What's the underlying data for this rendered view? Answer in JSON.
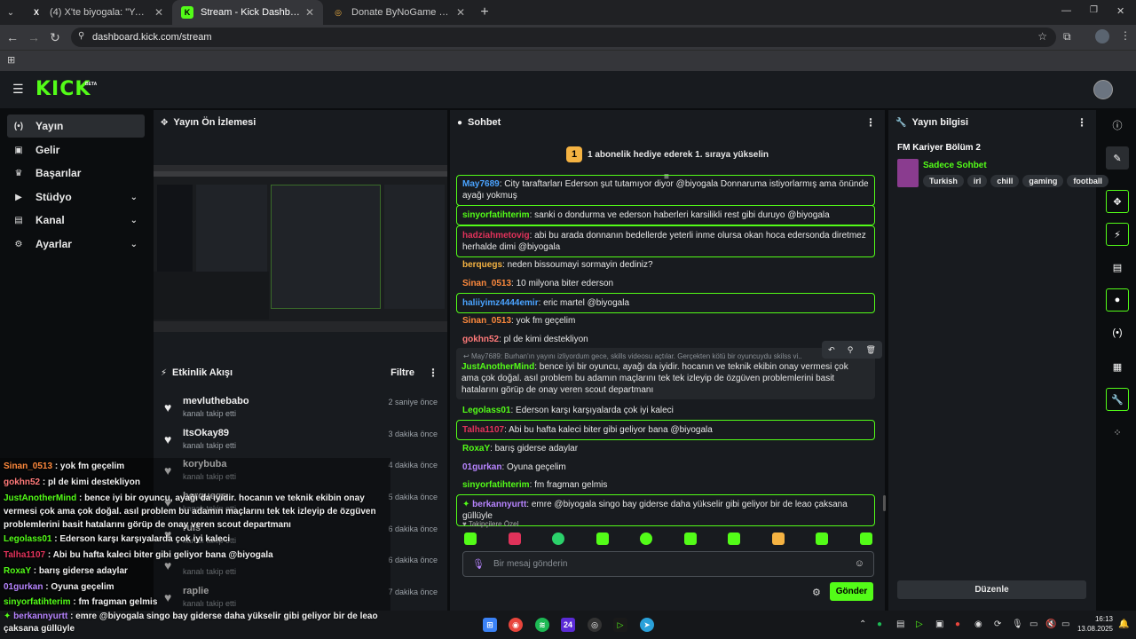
{
  "browser": {
    "tabs": [
      {
        "label": "(4) X'te biyogala: \"Yayındayız! F",
        "favicon": "x-logo-icon"
      },
      {
        "label": "Stream - Kick Dashboard",
        "favicon": "kick-logo-icon"
      },
      {
        "label": "Donate ByNoGame - Streamer",
        "favicon": "donate-icon"
      }
    ],
    "url": "dashboard.kick.com/stream"
  },
  "header": {
    "logo": "KICK",
    "badge": "BETA"
  },
  "sidebar": {
    "items": [
      {
        "label": "Yayın",
        "icon": "broadcast-icon"
      },
      {
        "label": "Gelir",
        "icon": "revenue-icon"
      },
      {
        "label": "Başarılar",
        "icon": "trophy-icon"
      },
      {
        "label": "Stüdyo",
        "icon": "studio-icon"
      },
      {
        "label": "Kanal",
        "icon": "channel-icon"
      },
      {
        "label": "Ayarlar",
        "icon": "gear-icon"
      }
    ]
  },
  "preview": {
    "title": "Yayın Ön İzlemesi"
  },
  "activity": {
    "title": "Etkinlik Akışı",
    "filter": "Filtre",
    "items": [
      {
        "name": "mevluthebabo",
        "sub": "kanalı takip etti",
        "time": "2 saniye önce"
      },
      {
        "name": "ItsOkay89",
        "sub": "kanalı takip etti",
        "time": "3 dakika önce"
      },
      {
        "name": "korybuba",
        "sub": "kanalı takip etti",
        "time": "4 dakika önce"
      },
      {
        "name": "berqueqs",
        "sub": "kanalı takip etti",
        "time": "5 dakika önce"
      },
      {
        "name": "ruis",
        "sub": "kanalı takip etti",
        "time": "6 dakika önce"
      },
      {
        "name": "",
        "sub": "kanalı takip etti",
        "time": "6 dakika önce"
      },
      {
        "name": "raplie",
        "sub": "kanalı takip etti",
        "time": "7 dakika önce"
      }
    ]
  },
  "chat": {
    "title": "Sohbet",
    "banner": "1 abonelik hediye ederek 1. sıraya yükselin",
    "messages": [
      {
        "user": "May7689",
        "color": "#4aa3ff",
        "text": ": City taraftarları Ederson şut tutamıyor diyor @biyogala Donnaruma istiyorlarmış ama önünde ayağı yokmuş",
        "hl": true
      },
      {
        "user": "sinyorfatihterim",
        "color": "#53fc18",
        "text": ": sanki o dondurma ve ederson haberleri karsilikli rest gibi duruyo @biyogala",
        "hl": true
      },
      {
        "user": "hadziahmetovig",
        "color": "#e0325a",
        "text": ": abi bu arada donnanın bedellerde yeterli inme olursa okan hoca edersonda diretmez herhalde dimi @biyogala",
        "hl": true
      },
      {
        "user": "berquegs",
        "color": "#f5b342",
        "text": ": neden bissoumayi sormayin dediniz?",
        "hl": false
      },
      {
        "user": "Sinan_0513",
        "color": "#ff8a3d",
        "text": ": 10 milyona biter ederson",
        "hl": false
      },
      {
        "user": "haliiyimz4444emir",
        "color": "#4aa3ff",
        "text": ": eric martel @biyogala",
        "hl": true
      },
      {
        "user": "Sinan_0513",
        "color": "#ff8a3d",
        "text": ": yok fm geçelim",
        "hl": false
      },
      {
        "user": "gokhn52",
        "color": "#ff7a7a",
        "text": ": pl de kimi destekliyon",
        "hl": false
      },
      {
        "user": "Legolass01",
        "color": "#53fc18",
        "text": ": Ederson karşı karşıyalarda çok iyi kaleci",
        "hl": false
      },
      {
        "user": "Talha1107",
        "color": "#e0325a",
        "text": ": Abi bu hafta kaleci biter gibi geliyor bana @biyogala",
        "hl": true
      },
      {
        "user": "RoxaY",
        "color": "#53fc18",
        "text": ": barış giderse adaylar",
        "hl": false
      },
      {
        "user": "01gurkan",
        "color": "#b784ff",
        "text": ": Oyuna geçelim",
        "hl": false
      },
      {
        "user": "sinyorfatihterim",
        "color": "#53fc18",
        "text": ": fm fragman gelmis",
        "hl": false
      },
      {
        "user": "berkannyurtt",
        "color": "#b784ff",
        "text": ": emre @biyogala singo bay giderse daha yükselir gibi geliyor bir de leao çaksana güllüyle",
        "hl": true
      }
    ],
    "reply": {
      "context": "May7689: Burhan'ın yayını izliyordum gece, skills videosu açtılar. Gerçekten kötü bir oyuncuydu skilss vi..",
      "user": "JustAnotherMind",
      "color": "#53fc18",
      "text": ": bence iyi bir oyuncu, ayağı da iyidir. hocanın ve teknik ekibin onay vermesi çok ama çok doğal. asıl problem bu adamın maçlarını tek tek izleyip de özgüven problemlerini basit hatalarını görüp de onay veren scout departmanı"
    },
    "emote_label": "Takipçilere Özel",
    "input_placeholder": "Bir mesaj gönderin",
    "send_label": "Gönder"
  },
  "stream_info": {
    "title": "Yayın bilgisi",
    "stream_title": "FM Kariyer Bölüm 2",
    "category": "Sadece Sohbet",
    "tags": [
      "Turkish",
      "irl",
      "chill",
      "gaming",
      "football"
    ],
    "edit_label": "Düzenle"
  },
  "overlay_chat": [
    {
      "user": "Sinan_0513",
      "color": "#ff8a3d",
      "text": " : yok fm geçelim"
    },
    {
      "user": "gokhn52",
      "color": "#ff7a7a",
      "text": " : pl de kimi destekliyon"
    },
    {
      "user": "JustAnotherMind",
      "color": "#53fc18",
      "text": " : bence iyi bir oyuncu, ayağı da iyidir. hocanın ve teknik ekibin onay vermesi çok ama çok doğal. asıl problem bu adamın maçlarını tek tek izleyip de özgüven problemlerini basit hatalarını görüp de onay veren scout departmanı"
    },
    {
      "user": "Legolass01",
      "color": "#53fc18",
      "text": " : Ederson karşı karşıyalarda çok iyi kaleci"
    },
    {
      "user": "Talha1107",
      "color": "#e0325a",
      "text": " : Abi bu hafta kaleci biter gibi geliyor bana @biyogala"
    },
    {
      "user": "RoxaY",
      "color": "#53fc18",
      "text": " : barış giderse adaylar"
    },
    {
      "user": "01gurkan",
      "color": "#b784ff",
      "text": " : Oyuna geçelim"
    },
    {
      "user": "sinyorfatihterim",
      "color": "#53fc18",
      "text": " : fm fragman gelmis"
    },
    {
      "user": "berkannyurtt",
      "color": "#b784ff",
      "text": " : emre @biyogala singo bay giderse daha yükselir gibi geliyor bir de leao çaksana güllüyle"
    }
  ],
  "taskbar": {
    "time": "16:13",
    "date": "13.08.2025",
    "badge": "24"
  },
  "colors": {
    "accent": "#53fc18",
    "panel": "#181b1f",
    "bg": "#0b0d0f"
  }
}
